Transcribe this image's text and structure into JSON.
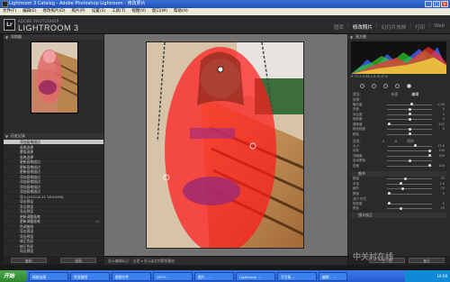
{
  "window": {
    "title": "Lightroom 3 Catalog - Adobe Photoshop Lightroom - 修改照片",
    "controls": [
      "_",
      "□",
      "×"
    ]
  },
  "menu": [
    "文件(F)",
    "编辑(E)",
    "修改照片(D)",
    "照片(P)",
    "设置(S)",
    "工具(T)",
    "视图(V)",
    "窗口(W)",
    "帮助(H)"
  ],
  "identity": {
    "logo": "Lr",
    "brand_small": "ADOBE PHOTOSHOP",
    "brand_large": "LIGHTROOM 3",
    "modules": [
      "图库",
      "修改照片",
      "幻灯片放映",
      "打印",
      "Web"
    ],
    "active_module": "修改照片"
  },
  "left_panel": {
    "navigator_title": "导航器",
    "history_title": "历史记录",
    "history": [
      "添加画笔描边",
      "画笔选择",
      "蒙版选择",
      "画笔选择",
      "更新画笔描边",
      "更新画笔描边",
      "更新画笔描边",
      "添加画笔描边",
      "添加画笔描边",
      "添加画笔描边",
      "添加画笔描边",
      "导入(2010-8-11 18:03:50)",
      "导出预设",
      "导出预设",
      "导出预设",
      "更新调整画笔",
      "更新调整画笔",
      "色调曲线",
      "导出预设",
      "导出预设",
      "修正色彩",
      "修正色彩",
      "导出预设"
    ],
    "history_numbers": [
      "",
      "",
      "",
      "",
      "",
      "",
      "",
      "",
      "",
      "",
      "",
      "",
      "",
      "",
      "",
      "",
      "41",
      "",
      "",
      "",
      "",
      "",
      ""
    ],
    "buttons": [
      "复制",
      "粘贴"
    ]
  },
  "toolbar": {
    "text": "显示编辑标记：  总是 ▾   显示选定的蒙版叠加"
  },
  "right_panel": {
    "histogram_title": "直方图",
    "hist_readout": "R 72.3  G 68.1  B 61.8 %",
    "mode_label": "蒙版：",
    "mode_options": [
      "新建",
      "编辑"
    ],
    "effect_label": "效果：",
    "sliders_a": [
      {
        "label": "曝光度",
        "value": "0.26",
        "pos": 0.55
      },
      {
        "label": "亮度",
        "value": "0",
        "pos": 0.5
      },
      {
        "label": "对比度",
        "value": "0",
        "pos": 0.5
      },
      {
        "label": "饱和度",
        "value": "0",
        "pos": 0.5
      },
      {
        "label": "清晰度",
        "value": "-100",
        "pos": 0.05
      },
      {
        "label": "锐化程度",
        "value": "0",
        "pos": 0.5
      },
      {
        "label": "颜色",
        "value": "",
        "pos": 0.5
      }
    ],
    "brush_label": "画笔：",
    "brush_options": [
      "A",
      "B",
      "擦除"
    ],
    "sliders_b": [
      {
        "label": "大小",
        "value": "15.8",
        "pos": 0.62
      },
      {
        "label": "羽化",
        "value": "100",
        "pos": 0.95
      },
      {
        "label": "流畅度",
        "value": "100",
        "pos": 0.95
      },
      {
        "label": "自动蒙版",
        "value": "",
        "pos": 0.5
      },
      {
        "label": "密度",
        "value": "100",
        "pos": 0.95
      }
    ],
    "section_c": "细节",
    "sliders_c": [
      {
        "label": "数量",
        "value": "25",
        "pos": 0.4
      },
      {
        "label": "半径",
        "value": "1.0",
        "pos": 0.3
      },
      {
        "label": "细节",
        "value": "25",
        "pos": 0.35
      },
      {
        "label": "蒙版",
        "value": "0",
        "pos": 0.05
      }
    ],
    "section_d": "减少杂色",
    "sliders_d": [
      {
        "label": "明亮度",
        "value": "0",
        "pos": 0.05
      },
      {
        "label": "颜色",
        "value": "25",
        "pos": 0.3
      }
    ],
    "bottom_label": "镜头校正",
    "buttons": [
      "上一张",
      "复位"
    ]
  },
  "taskbar": {
    "start": "开始",
    "tasks": [
      "网络连接",
      "界面截图",
      "截图文件",
      "LRC3 ...",
      "图片 - ...",
      "Lightroom ...",
      "写字板 ...",
      "编辑 - ...",
      "Lightroom"
    ],
    "clock": "16:08"
  },
  "watermark": "中关村在线",
  "colors": {
    "panel": "#2a2a2a",
    "center_bg": "#727272",
    "mask_overlay": "#ff0000",
    "xp_blue": "#245cd0"
  }
}
